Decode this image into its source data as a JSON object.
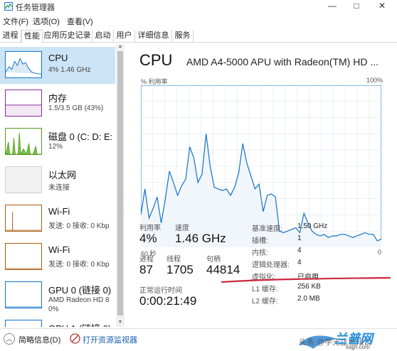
{
  "window": {
    "title": "任务管理器",
    "minimize": "—",
    "maximize": "□",
    "close": "✕"
  },
  "menu": [
    "文件(F)",
    "选项(O)",
    "查看(V)"
  ],
  "tabs": [
    "进程",
    "性能",
    "应用历史记录",
    "启动",
    "用户",
    "详细信息",
    "服务"
  ],
  "active_tab": "性能",
  "sidebar": [
    {
      "title": "CPU",
      "sub": "4% 1.46 GHz",
      "sub2": "",
      "color": "#1173c7",
      "selected": true
    },
    {
      "title": "内存",
      "sub": "1.5/3.5 GB (43%)",
      "sub2": "",
      "color": "#8b2a9b",
      "selected": false
    },
    {
      "title": "磁盘 0 (C: D: E:",
      "sub": "12%",
      "sub2": "",
      "color": "#4d9c1f",
      "selected": false
    },
    {
      "title": "以太网",
      "sub": "未连接",
      "sub2": "",
      "color": "#a0a0a0",
      "selected": false
    },
    {
      "title": "Wi-Fi",
      "sub": "发送: 0 接收: 0 Kbp",
      "sub2": "",
      "color": "#a75d12",
      "selected": false
    },
    {
      "title": "Wi-Fi",
      "sub": "发送: 0 接收: 0 Kbp",
      "sub2": "",
      "color": "#a75d12",
      "selected": false
    },
    {
      "title": "GPU 0 (链接 0)",
      "sub": "AMD Radeon HD 8",
      "sub2": "0%",
      "color": "#1173c7",
      "selected": false
    },
    {
      "title": "GPU 1 (链接 0)",
      "sub": "",
      "sub2": "",
      "color": "#1173c7",
      "selected": false
    }
  ],
  "main": {
    "heading": "CPU",
    "model": "AMD A4-5000 APU with Radeon(TM) HD ...",
    "graph_label_left": "% 利用率",
    "graph_label_right": "100%",
    "graph_time_left": "60 秒",
    "graph_time_right": "0",
    "graph_color": "#1173c7",
    "graph_fill": "#f1f6fb"
  },
  "chart_data": {
    "type": "area",
    "ylabel": "% 利用率",
    "ylim": [
      0,
      100
    ],
    "xlim": [
      60,
      0
    ],
    "x_unit": "秒",
    "grid": true,
    "y": [
      20,
      36,
      18,
      24,
      31,
      15,
      30,
      47,
      40,
      32,
      38,
      42,
      62,
      55,
      40,
      45,
      70,
      50,
      37,
      36,
      35,
      36,
      32,
      37,
      46,
      64,
      52,
      44,
      36,
      39,
      22,
      32,
      33,
      31,
      10,
      9,
      10,
      11,
      12,
      9,
      21,
      15,
      10,
      8,
      7,
      8,
      6,
      7,
      7,
      8,
      8,
      7,
      6,
      7,
      8,
      9,
      8,
      8,
      4,
      5
    ]
  },
  "stats": {
    "util_label": "利用率",
    "util_value": "4%",
    "speed_label": "速度",
    "speed_value": "1.46 GHz",
    "proc_label": "进程",
    "proc_value": "87",
    "thread_label": "线程",
    "thread_value": "1705",
    "handle_label": "句柄",
    "handle_value": "44814",
    "uptime_label": "正常运行时间",
    "uptime_value": "0:00:21:49"
  },
  "details": [
    {
      "k": "基准速度:",
      "v": "1.50 GHz"
    },
    {
      "k": "插槽:",
      "v": "1"
    },
    {
      "k": "内核:",
      "v": "4"
    },
    {
      "k": "逻辑处理器:",
      "v": "4"
    },
    {
      "k": "虚拟化:",
      "v": "已启用"
    },
    {
      "k": "L1 缓存:",
      "v": "256 KB"
    },
    {
      "k": "L2 缓存:",
      "v": "2.0 MB"
    }
  ],
  "annotation_color": "#c9283e",
  "footer": {
    "chevron": "︿",
    "less": "简略信息(D)",
    "resmon": "打开资源监视器"
  },
  "watermark": {
    "text": "头条 @学无止境知识",
    "brand": "兰普网",
    "url": "xajjn.com"
  }
}
